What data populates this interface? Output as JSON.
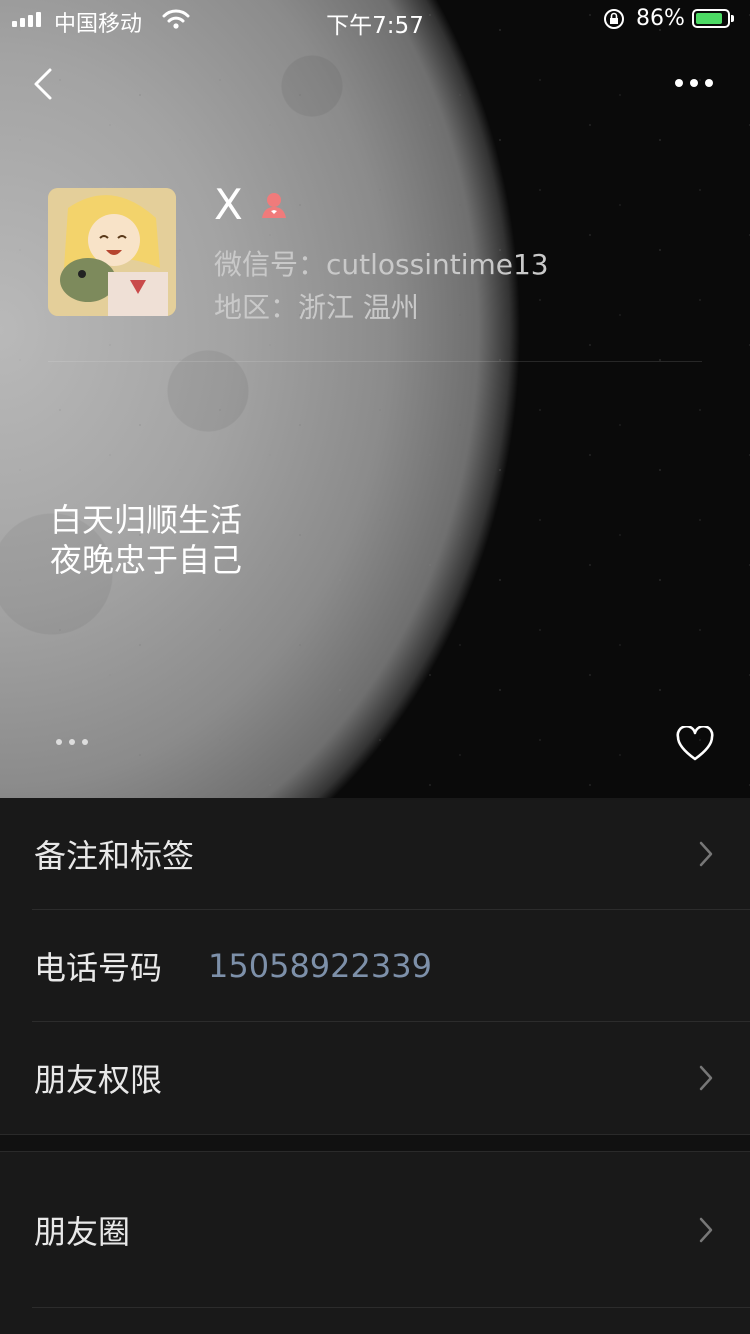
{
  "status_bar": {
    "carrier": "中国移动",
    "time": "下午7:57",
    "battery_percent": "86%",
    "battery_level": 0.86
  },
  "profile": {
    "name": "X",
    "wechat_id": "微信号：cutlossintime13",
    "region": "地区：浙江 温州",
    "signature": "白天归顺生活\n夜晚忠于自己"
  },
  "menu": {
    "remarks_label": "备注和标签",
    "phone_label": "电话号码",
    "phone_value": "15058922339",
    "permissions_label": "朋友权限",
    "moments_label": "朋友圈"
  },
  "colors": {
    "background": "#191919",
    "phone_value": "#7d90a9",
    "female_icon": "#f07b7b",
    "battery_fill": "#4cd964"
  },
  "icons": [
    "signal-icon",
    "wifi-icon",
    "orientation-lock-icon",
    "battery-icon",
    "back-icon",
    "more-icon",
    "female-icon",
    "dots-icon",
    "heart-icon",
    "chevron-right-icon"
  ]
}
